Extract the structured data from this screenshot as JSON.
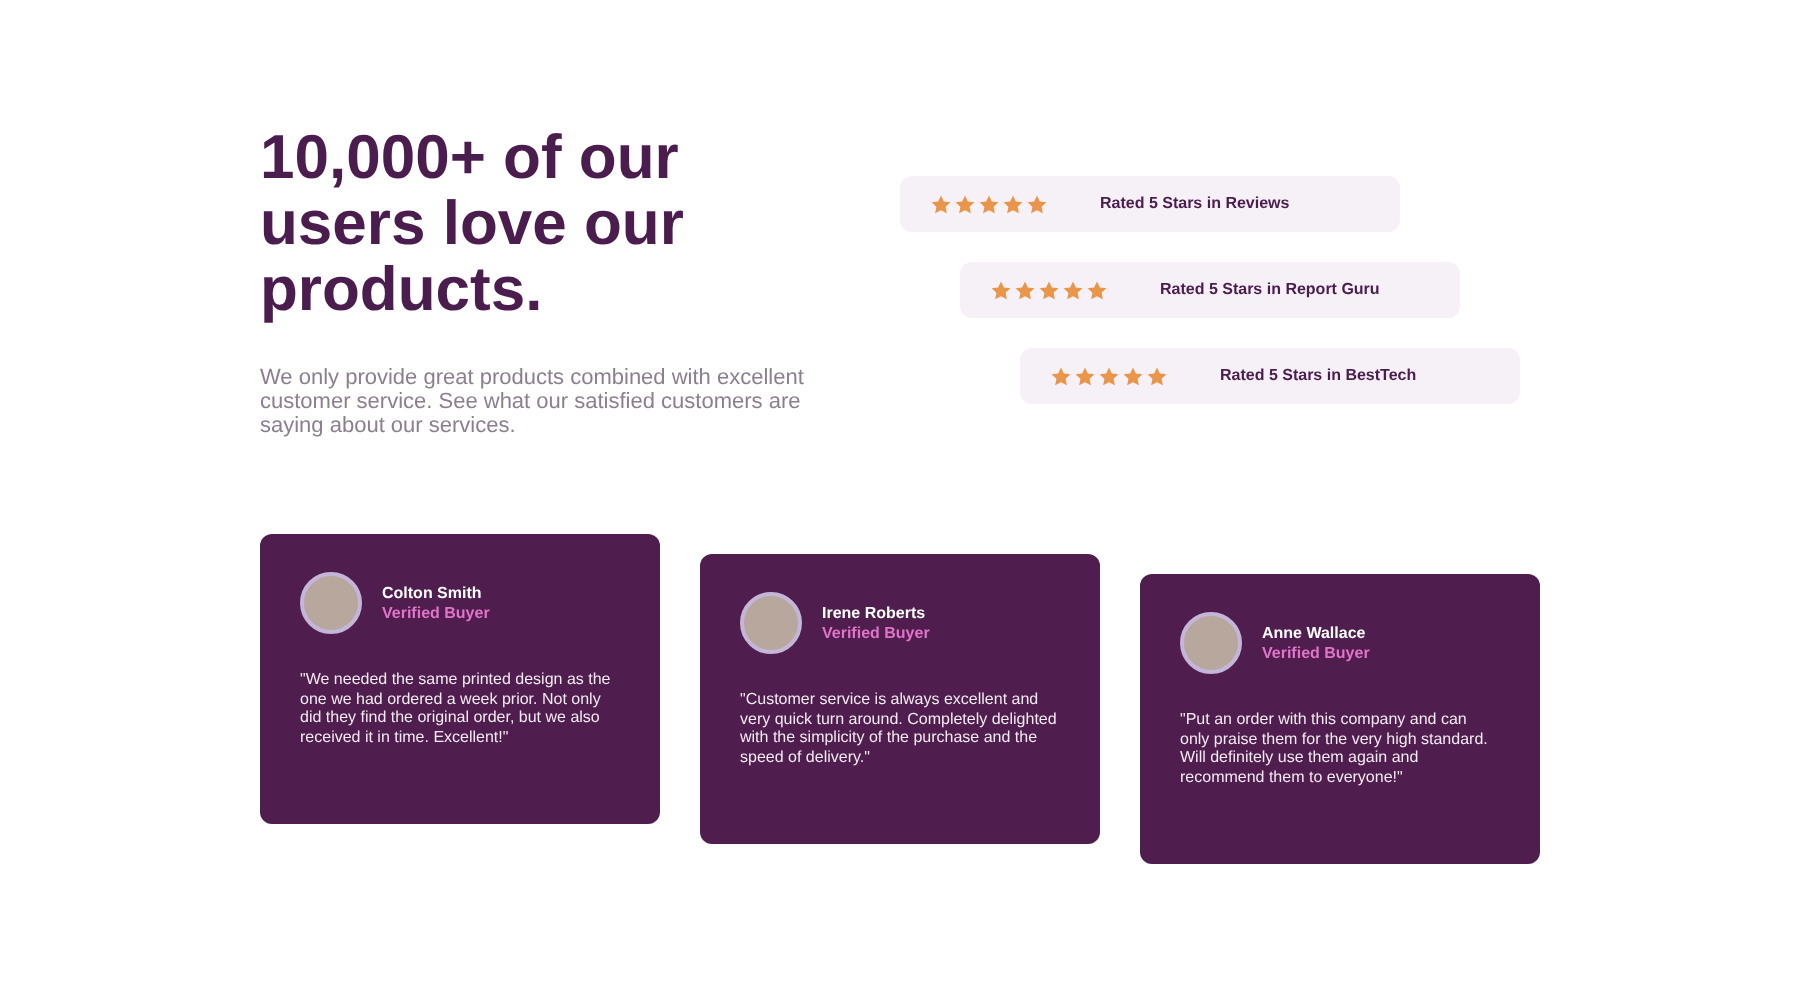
{
  "heading": "10,000+ of our users love our products.",
  "intro": "We only provide great products combined with excellent customer service. See what our satisfied customers are saying about our services.",
  "ratings": [
    {
      "stars": 5,
      "label": "Rated 5 Stars in Reviews"
    },
    {
      "stars": 5,
      "label": "Rated 5 Stars in Report Guru"
    },
    {
      "stars": 5,
      "label": "Rated 5 Stars in BestTech"
    }
  ],
  "testimonials": [
    {
      "name": "Colton Smith",
      "badge": "Verified Buyer",
      "quote": "\"We needed the same printed design as the one we had ordered a week prior. Not only did they find the original order, but we also received it in time. Excellent!\""
    },
    {
      "name": "Irene Roberts",
      "badge": "Verified Buyer",
      "quote": "\"Customer service is always excellent and very quick turn around. Completely delighted with the simplicity of the purchase and the speed of delivery.\""
    },
    {
      "name": "Anne Wallace",
      "badge": "Verified Buyer",
      "quote": "\"Put an order with this company and can only praise them for the very high standard. Will definitely use them again and recommend them to everyone!\""
    }
  ]
}
